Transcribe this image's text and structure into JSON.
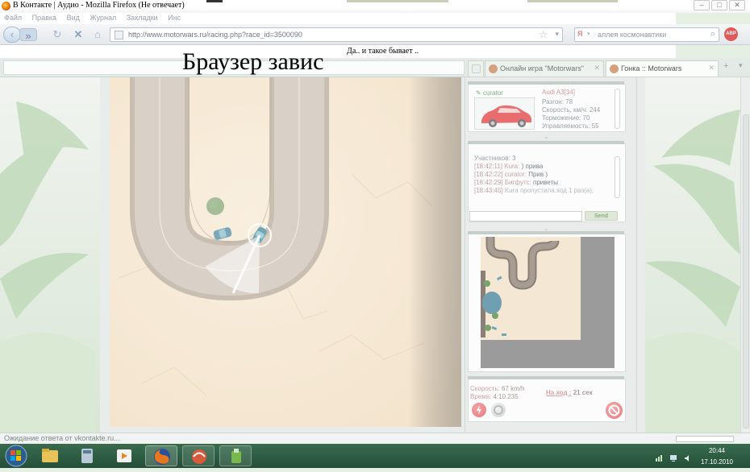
{
  "window": {
    "title": "В Контакте | Аудио - Mozilla Firefox (Не отвечает)",
    "buttons": [
      "–",
      "□",
      "✕"
    ]
  },
  "menu": [
    "Файл",
    "Правка",
    "Вид",
    "Журнал",
    "Закладки",
    "Инс"
  ],
  "nav": {
    "url": "http://www.motorwars.ru/racing.php?race_id=3500090",
    "search_value": "аллея космонавтики",
    "abp_label": "ABP"
  },
  "page_message": "Да.. и такое бывает ..",
  "annotation": "Браузер завис",
  "tabs": [
    {
      "label": "",
      "icon": "page-icon"
    },
    {
      "label": "Онлайн игра \"Motorwars\"",
      "icon": "motorwars-icon"
    },
    {
      "label": "Гонка :: Motorwars",
      "icon": "motorwars-icon",
      "active": true
    }
  ],
  "car_panel": {
    "owner": "curator",
    "car_name": "Audi A3[34]",
    "stats": [
      "Разгон: 78",
      "Скорость, км/ч: 244",
      "Торможение: 70",
      "Управляемость: 55"
    ]
  },
  "chat": {
    "participants": "Участников: 3",
    "lines": [
      {
        "ts": "[18:42:11]",
        "nick": "Kura:",
        "text": ") прива"
      },
      {
        "ts": "[18:42:22]",
        "nick": "curator:",
        "text": "Прив )"
      },
      {
        "ts": "[18:42:29]",
        "nick": "Бигфутс:",
        "text": "приветы"
      },
      {
        "ts": "[18:43:45]",
        "nick": "",
        "text": "Kura пропустила ход 1 раз(а)."
      }
    ],
    "send_label": "Send"
  },
  "race_status": {
    "speed_label": "Скорость:",
    "speed_value": "67 km/h",
    "time_label": "Время:",
    "time_value": "4:10.235",
    "turn_label": "На ход :",
    "turn_value": "21 сек"
  },
  "statusbar": "Ожидание ответа от vkontakte.ru...",
  "clock": {
    "time": "20:44",
    "date": "17.10.2010"
  },
  "colors": {
    "accent": "#d59ca2",
    "sand": "#f7ebd9",
    "road": "#cfc6bc",
    "taskbar": "#2f5f45"
  }
}
